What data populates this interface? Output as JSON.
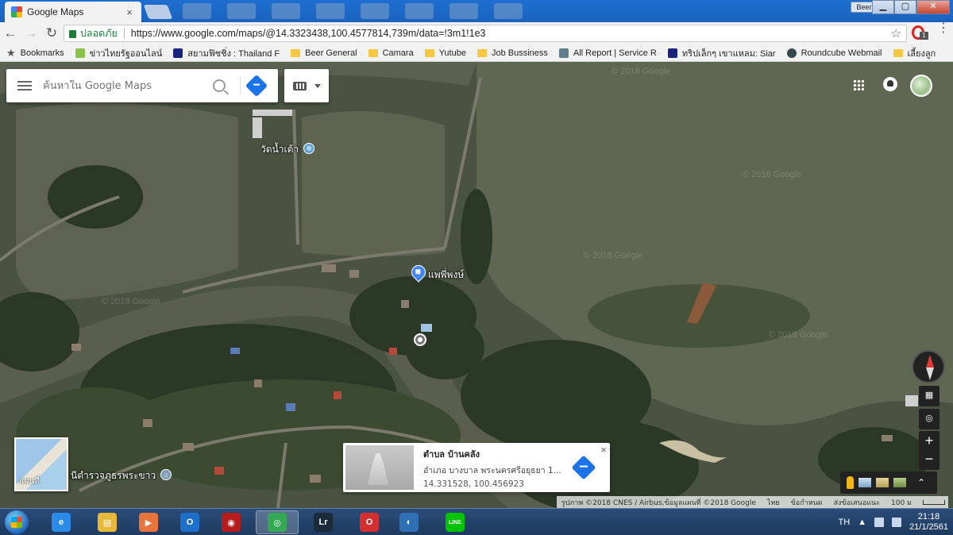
{
  "browser": {
    "tab_title": "Google Maps",
    "tab_close": "×",
    "profile_name": "Beer",
    "window_buttons": {
      "minimize": "▁",
      "maximize": "▢",
      "close": "✕"
    },
    "omnibox": {
      "secure_label": "ปลอดภัย",
      "url": "https://www.google.com/maps/@14.3323438,100.4577814,739m/data=!3m1!1e3"
    },
    "nav": {
      "back": "←",
      "forward": "→",
      "reload": "↻",
      "bookmark_star": "☆",
      "menu": "⋮"
    },
    "extension_badge": "1"
  },
  "bookmarks": [
    {
      "label": "Bookmarks",
      "icon": "star-icon"
    },
    {
      "label": "ข่าวไทยรัฐออนไลน์",
      "icon": "site-icon"
    },
    {
      "label": "สยามฟิชชิ่ง : Thailand F",
      "icon": "site-icon"
    },
    {
      "label": "Beer General",
      "icon": "folder-icon"
    },
    {
      "label": "Camara",
      "icon": "folder-icon"
    },
    {
      "label": "Yutube",
      "icon": "folder-icon"
    },
    {
      "label": "Job Bussiness",
      "icon": "folder-icon"
    },
    {
      "label": "All Report | Service R",
      "icon": "site-icon"
    },
    {
      "label": "ทริปเล็กๆ เขาแหลม: Siar",
      "icon": "site-icon"
    },
    {
      "label": "Roundcube Webmail",
      "icon": "site-icon"
    },
    {
      "label": "เลี้ยงลูก",
      "icon": "folder-icon"
    }
  ],
  "maps": {
    "search_placeholder": "ค้นหาใน Google Maps",
    "labels": {
      "temple": "วัดน้ำเต้า",
      "pin": "แพพี่พงษ์",
      "police": "นีตำรวจภูธรพระขาว"
    },
    "watermark": "© 2018 Google",
    "layers_label": "แผนที่",
    "card": {
      "title": "ตำบล บ้านคลัง",
      "subtitle": "อำเภอ บางบาล พระนครศรีอยุธยา 1...",
      "coords": "14.331528, 100.456923",
      "close": "×"
    },
    "controls": {
      "zoom_in": "+",
      "zoom_out": "−",
      "expand": "⌃"
    },
    "attribution": {
      "credits": "รูปภาพ ©2018 CNES / Airbus,ข้อมูลแผนที่ ©2018 Google",
      "language": "ไทย",
      "terms": "ข้อกำหนด",
      "feedback": "ส่งข้อเสนอแนะ",
      "scale": "100 ม"
    }
  },
  "taskbar": {
    "apps": [
      {
        "name": "internet-explorer",
        "glyph": "e",
        "color": "#2a8be8"
      },
      {
        "name": "file-explorer",
        "glyph": "▤",
        "color": "#e6b93b"
      },
      {
        "name": "media-player",
        "glyph": "▶",
        "color": "#e8743b"
      },
      {
        "name": "outlook",
        "glyph": "O",
        "color": "#1e6fc9"
      },
      {
        "name": "red-app",
        "glyph": "◉",
        "color": "#b71c1c"
      },
      {
        "name": "chrome",
        "glyph": "◎",
        "color": "#34a853"
      },
      {
        "name": "lightroom",
        "glyph": "Lr",
        "color": "#1c2b3a"
      },
      {
        "name": "opera",
        "glyph": "O",
        "color": "#d32f2f"
      },
      {
        "name": "teamviewer",
        "glyph": "◐",
        "color": "#2f6fb3"
      },
      {
        "name": "line",
        "glyph": "LINE",
        "color": "#00c300"
      }
    ],
    "language": "TH",
    "time": "21:18",
    "date": "21/1/2561"
  }
}
